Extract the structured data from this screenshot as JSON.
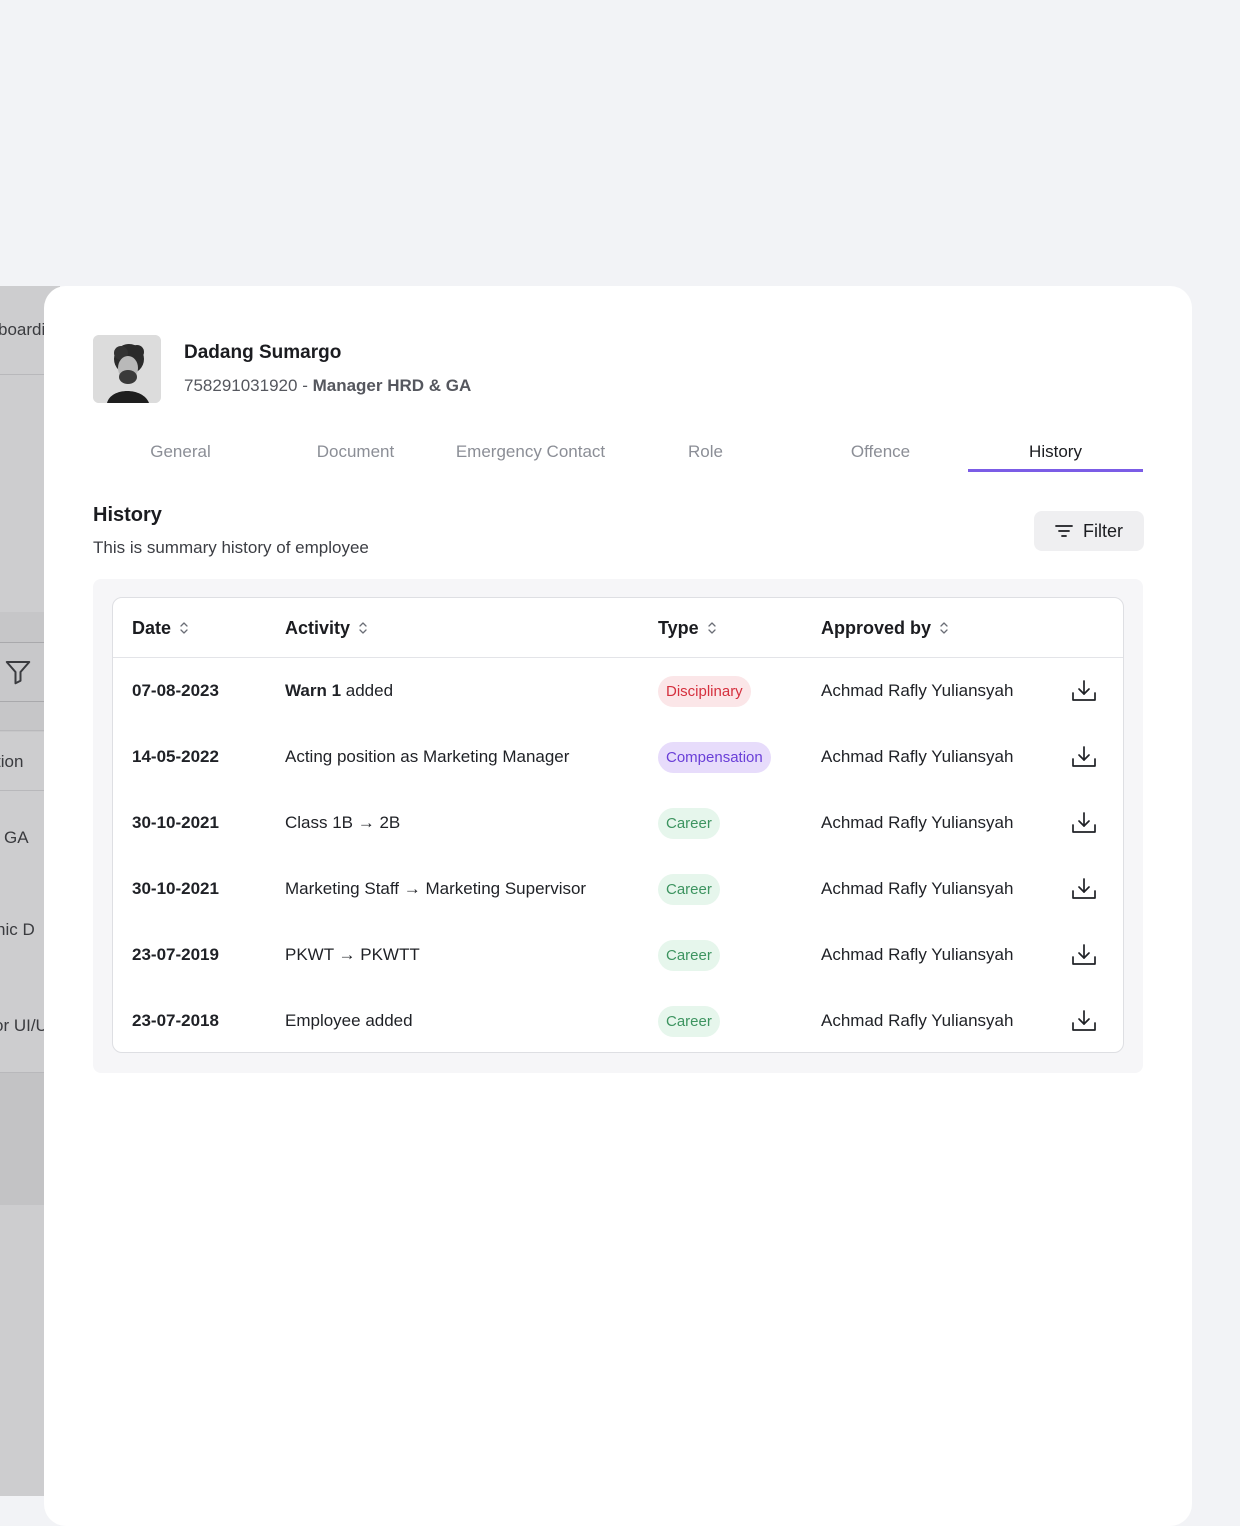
{
  "background_page": {
    "fragments": [
      "boardi",
      "tion",
      "GA",
      "hic D",
      "or UI/U"
    ]
  },
  "employee": {
    "name": "Dadang Sumargo",
    "id": "758291031920",
    "separator": " - ",
    "role": "Manager HRD & GA"
  },
  "tabs": [
    {
      "label": "General",
      "active": false
    },
    {
      "label": "Document",
      "active": false
    },
    {
      "label": "Emergency Contact",
      "active": false
    },
    {
      "label": "Role",
      "active": false
    },
    {
      "label": "Offence",
      "active": false
    },
    {
      "label": "History",
      "active": true
    }
  ],
  "section": {
    "title": "History",
    "subtitle": "This is summary history of employee",
    "filter_label": "Filter"
  },
  "table": {
    "headers": {
      "date": "Date",
      "activity": "Activity",
      "type": "Type",
      "approved_by": "Approved by"
    },
    "rows": [
      {
        "date": "07-08-2023",
        "activity_bold": "Warn 1",
        "activity": " added",
        "type": "Disciplinary",
        "type_class": "disc",
        "approved_by": "Achmad Rafly Yuliansyah"
      },
      {
        "date": "14-05-2022",
        "activity_bold": "",
        "activity": "Acting position as Marketing Manager",
        "type": "Compensation",
        "type_class": "comp",
        "approved_by": "Achmad Rafly Yuliansyah"
      },
      {
        "date": "30-10-2021",
        "activity_bold": "",
        "activity": "Class 1B → 2B",
        "type": "Career",
        "type_class": "career",
        "approved_by": "Achmad Rafly Yuliansyah"
      },
      {
        "date": "30-10-2021",
        "activity_bold": "",
        "activity": "Marketing Staff → Marketing Supervisor",
        "type": "Career",
        "type_class": "career",
        "approved_by": "Achmad Rafly Yuliansyah"
      },
      {
        "date": "23-07-2019",
        "activity_bold": "",
        "activity": "PKWT → PKWTT",
        "type": "Career",
        "type_class": "career",
        "approved_by": "Achmad Rafly Yuliansyah"
      },
      {
        "date": "23-07-2018",
        "activity_bold": "",
        "activity": "Employee added",
        "type": "Career",
        "type_class": "career",
        "approved_by": "Achmad Rafly Yuliansyah"
      }
    ]
  },
  "colors": {
    "accent": "#7b5ce6",
    "disciplinary": "#d5303e",
    "compensation": "#6a3fd8",
    "career": "#3d9460"
  },
  "icons": {
    "sort": "sort-icon",
    "download": "download-icon",
    "filter": "filter-icon"
  }
}
